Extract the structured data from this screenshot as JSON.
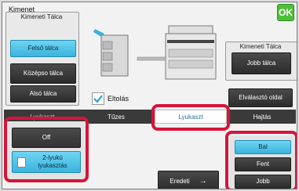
{
  "title": "Kimenet",
  "ok_label": "OK",
  "left_group": {
    "label": "Kimeneti Tálca",
    "buttons": [
      {
        "label": "Felső tálca",
        "selected": true
      },
      {
        "label": "Középso tálca",
        "selected": false
      },
      {
        "label": "Alsó tálca",
        "selected": false
      }
    ]
  },
  "right_group": {
    "label": "Kimeneti Tálca",
    "button": "Jobb tálca"
  },
  "offset_checkbox": {
    "label": "Eltolás",
    "checked": true
  },
  "separator_button": "Elválasztó oldal",
  "tabs": [
    {
      "label": "Lyukaszt",
      "active": false,
      "truncated": true
    },
    {
      "label": "Tűzes",
      "active": false
    },
    {
      "label": "Lyukaszt",
      "active": true
    },
    {
      "label": "Hajtás",
      "active": false
    }
  ],
  "punch_options": [
    {
      "label": "Off",
      "selected": false
    },
    {
      "label": "2-lyukú lyukasztás",
      "selected": true
    }
  ],
  "position_options": [
    {
      "label": "Bal",
      "selected": true
    },
    {
      "label": "Fent",
      "selected": false
    },
    {
      "label": "Jobb",
      "selected": false
    }
  ],
  "original_button": "Eredeti",
  "colors": {
    "accent": "#3ab3de",
    "highlight": "#d6143a",
    "ok": "#4fbf3a"
  }
}
